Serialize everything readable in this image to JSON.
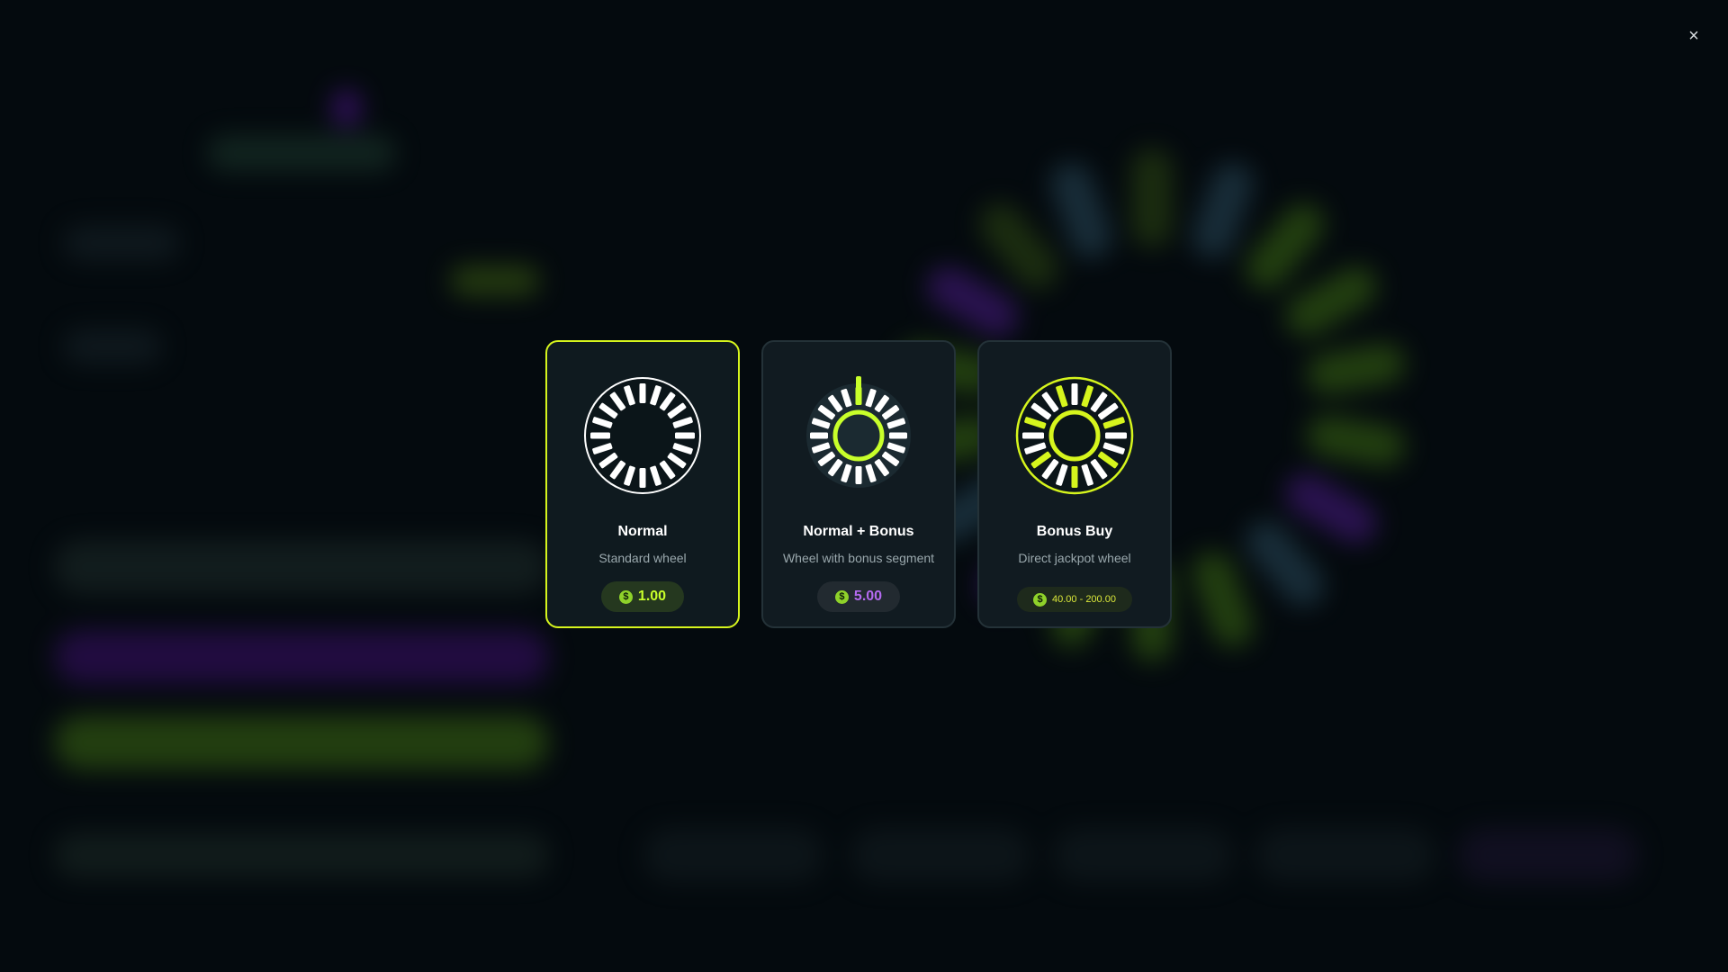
{
  "close": {
    "glyph": "×"
  },
  "cards": [
    {
      "title": "Normal",
      "subtitle": "Standard wheel",
      "price": "1.00",
      "selected": true
    },
    {
      "title": "Normal + Bonus",
      "subtitle": "Wheel with bonus segment",
      "price": "5.00",
      "selected": false
    },
    {
      "title": "Bonus Buy",
      "subtitle": "Direct jackpot wheel",
      "price": "40.00 - 200.00",
      "selected": false
    }
  ],
  "currency_symbol": "$",
  "colors": {
    "accent": "#d6f51d",
    "bonus": "#b46af0",
    "price_green": "#c8ff2a"
  },
  "icons": [
    "close-icon",
    "wheel-icon",
    "coin-icon"
  ]
}
